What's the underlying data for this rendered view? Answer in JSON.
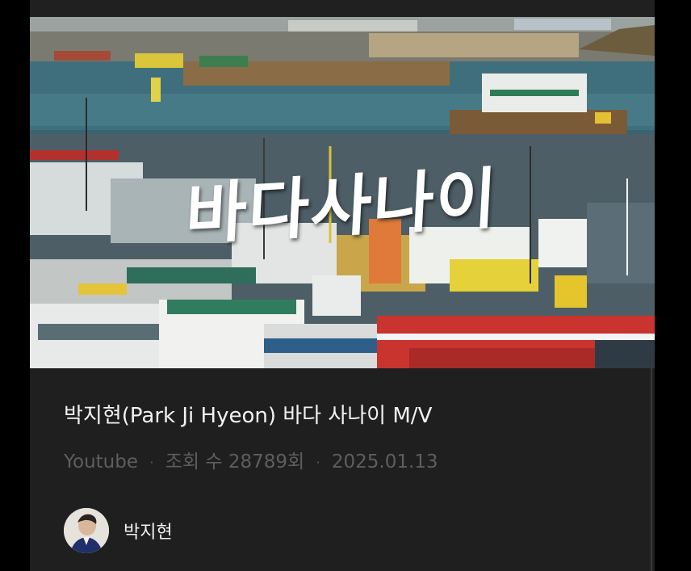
{
  "thumbnail": {
    "overlay_title": "바다사나이"
  },
  "video": {
    "title": "박지현(Park Ji Hyeon) 바다 사나이 M/V",
    "source": "Youtube",
    "separator": "·",
    "views": "조회 수 28789회",
    "date": "2025.01.13"
  },
  "channel": {
    "name": "박지현"
  },
  "colors": {
    "background": "#000000",
    "card": "#1f1f1f",
    "title_text": "#f2f2f2",
    "meta_text": "#5e5e5e"
  }
}
